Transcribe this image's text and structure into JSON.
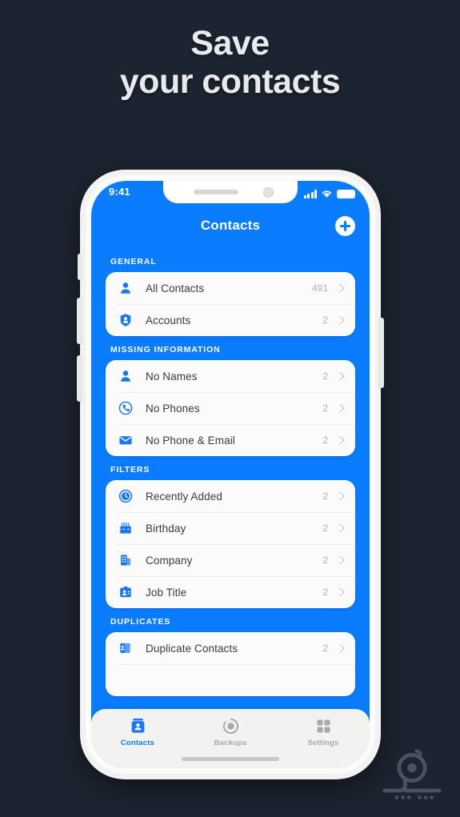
{
  "headline": {
    "line1": "Save",
    "line2": "your contacts"
  },
  "colors": {
    "background": "#1b2430",
    "accent": "#0a7cff",
    "card": "#fbfbfb",
    "headline_text": "#e8eaed",
    "count_text": "#b0b0b0",
    "tab_inactive": "#a8a8a8"
  },
  "phone": {
    "status_bar": {
      "time": "9:41",
      "signal_icon": "signal-bars-icon",
      "wifi_icon": "wifi-icon",
      "battery_icon": "battery-icon"
    },
    "navbar": {
      "title": "Contacts",
      "add_icon": "plus-icon"
    },
    "sections": [
      {
        "title": "GENERAL",
        "rows": [
          {
            "icon": "person-icon",
            "label": "All Contacts",
            "count": "491"
          },
          {
            "icon": "shield-person-icon",
            "label": "Accounts",
            "count": "2"
          }
        ]
      },
      {
        "title": "MISSING INFORMATION",
        "rows": [
          {
            "icon": "person-icon",
            "label": "No Names",
            "count": "2"
          },
          {
            "icon": "phone-circle-icon",
            "label": "No Phones",
            "count": "2"
          },
          {
            "icon": "envelope-icon",
            "label": "No Phone & Email",
            "count": "2"
          }
        ]
      },
      {
        "title": "FILTERS",
        "rows": [
          {
            "icon": "clock-icon",
            "label": "Recently Added",
            "count": "2"
          },
          {
            "icon": "birthday-cake-icon",
            "label": "Birthday",
            "count": "2"
          },
          {
            "icon": "building-icon",
            "label": "Company",
            "count": "2"
          },
          {
            "icon": "id-badge-icon",
            "label": "Job Title",
            "count": "2"
          }
        ]
      },
      {
        "title": "DUPLICATES",
        "rows": [
          {
            "icon": "duplicate-contacts-icon",
            "label": "Duplicate Contacts",
            "count": "2"
          }
        ]
      }
    ],
    "tabs": [
      {
        "icon": "contacts-card-icon",
        "label": "Contacts",
        "active": true
      },
      {
        "icon": "backup-refresh-icon",
        "label": "Backups",
        "active": false
      },
      {
        "icon": "grid-squares-icon",
        "label": "Settings",
        "active": false
      }
    ]
  }
}
